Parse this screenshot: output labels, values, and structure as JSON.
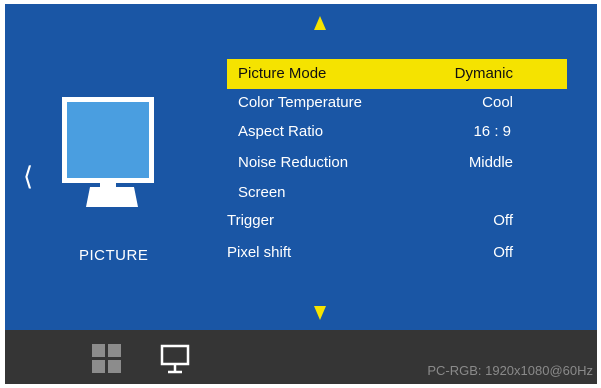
{
  "category": {
    "label": "PICTURE",
    "icon": "monitor-icon"
  },
  "navigation": {
    "up_icon": "triangle-up-icon",
    "down_icon": "triangle-down-icon",
    "back_glyph": "⟨"
  },
  "menu": {
    "items": [
      {
        "label": "Picture Mode",
        "value": "Dymanic",
        "selected": true
      },
      {
        "label": "Color Temperature",
        "value": "Cool"
      },
      {
        "label": "Aspect Ratio",
        "value": "16 : 9"
      },
      {
        "label": "Noise Reduction",
        "value": "Middle"
      },
      {
        "label": "Screen",
        "value": ""
      },
      {
        "label": "Trigger",
        "value": "Off"
      },
      {
        "label": "Pixel shift",
        "value": "Off"
      }
    ]
  },
  "bottom_bar": {
    "tabs": [
      {
        "name": "grid-icon",
        "active": false
      },
      {
        "name": "display-icon",
        "active": true
      }
    ],
    "status": "PC-RGB: 1920x1080@60Hz"
  },
  "colors": {
    "background": "#1a56a5",
    "highlight": "#f5e300",
    "bottom_bar": "#353535",
    "screen_fill": "#4a9ee0"
  }
}
